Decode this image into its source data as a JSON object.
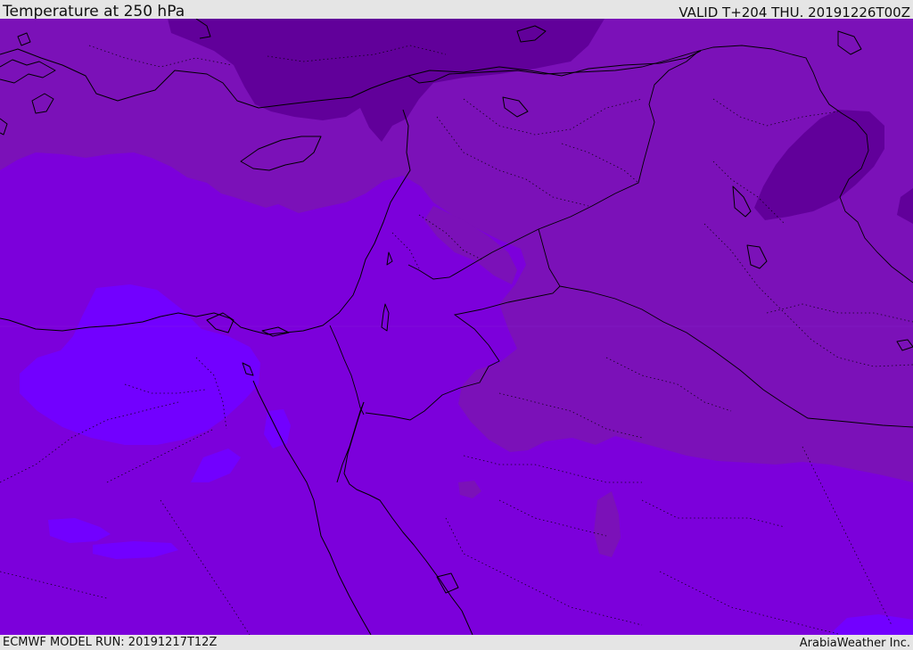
{
  "header": {
    "title": "Temperature at 250 hPa",
    "valid_time": "VALID T+204 THU. 20191226T00Z"
  },
  "footer": {
    "model_run": "ECMWF MODEL RUN: 20191217T12Z",
    "credit": "ArabiaWeather Inc."
  },
  "map": {
    "field": "temperature",
    "level": "250 hPa",
    "region": "Eastern Mediterranean and Middle East",
    "colors": {
      "base_violet": "#7c00db",
      "mid_violet": "#7b11b8",
      "dark_violet": "#61009a",
      "light_violet": "#7200ff",
      "coastline": "#000000"
    }
  }
}
